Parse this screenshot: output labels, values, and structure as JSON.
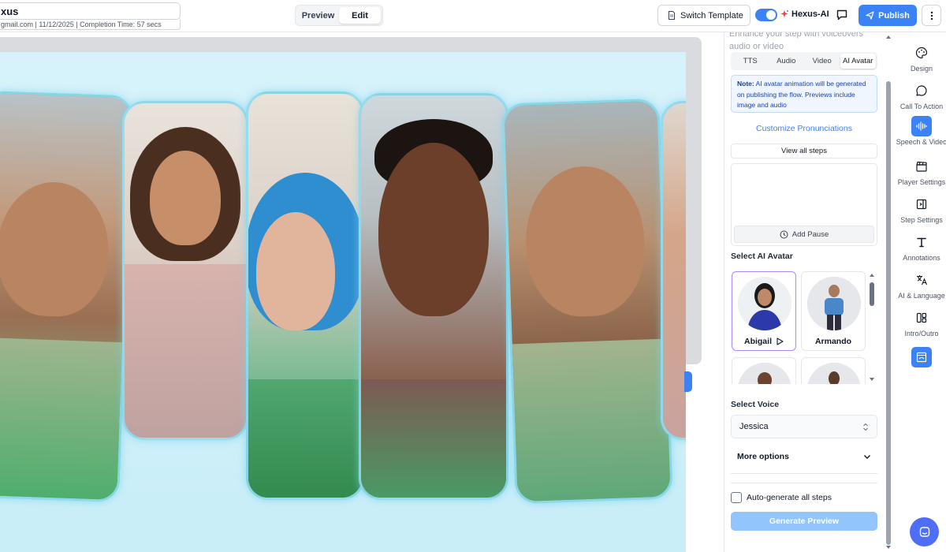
{
  "header": {
    "title": "xus",
    "meta": "gmail.com | 11/12/2025 | Completion Time: 57 secs",
    "mode_preview": "Preview",
    "mode_edit": "Edit",
    "switch_template": "Switch Template",
    "ai_label": "Hexus-AI",
    "publish": "Publish"
  },
  "panel": {
    "faded_text": "Enhance your step with voiceovers audio or video",
    "tabs": [
      "TTS",
      "Audio",
      "Video",
      "AI Avatar"
    ],
    "active_tab": "AI Avatar",
    "note_label": "Note:",
    "note_text": " AI avatar animation will be generated on publishing the flow. Previews include image and audio",
    "customize_link": "Customize Pronunciations",
    "view_all_steps": "View all steps",
    "add_pause": "Add Pause",
    "select_avatar_label": "Select AI Avatar",
    "avatars": [
      {
        "name": "Abigail",
        "selected": true
      },
      {
        "name": "Armando",
        "selected": false
      },
      {
        "name": "",
        "selected": false
      },
      {
        "name": "",
        "selected": false
      }
    ],
    "select_voice_label": "Select Voice",
    "voice_value": "Jessica",
    "more_options": "More options",
    "auto_generate": "Auto-generate all steps",
    "generate_preview": "Generate Preview"
  },
  "sidenav": {
    "items": [
      {
        "label": "Design",
        "icon": "palette-icon"
      },
      {
        "label": "Call To Action",
        "icon": "chat-bubble-icon"
      },
      {
        "label": "Speech & Video",
        "icon": "audio-wave-icon"
      },
      {
        "label": "Player Settings",
        "icon": "clapperboard-icon"
      },
      {
        "label": "Step Settings",
        "icon": "panel-layout-icon"
      },
      {
        "label": "Annotations",
        "icon": "text-t-icon"
      },
      {
        "label": "AI & Language",
        "icon": "translate-icon"
      },
      {
        "label": "Intro/Outro",
        "icon": "blocks-layout-icon"
      },
      {
        "label": "",
        "icon": "image-frame-icon"
      }
    ],
    "active": "Speech & Video"
  },
  "colors": {
    "accent": "#3b82f6",
    "stage_bg": "#d7f2fb",
    "card_glow": "#8cdcf0"
  }
}
